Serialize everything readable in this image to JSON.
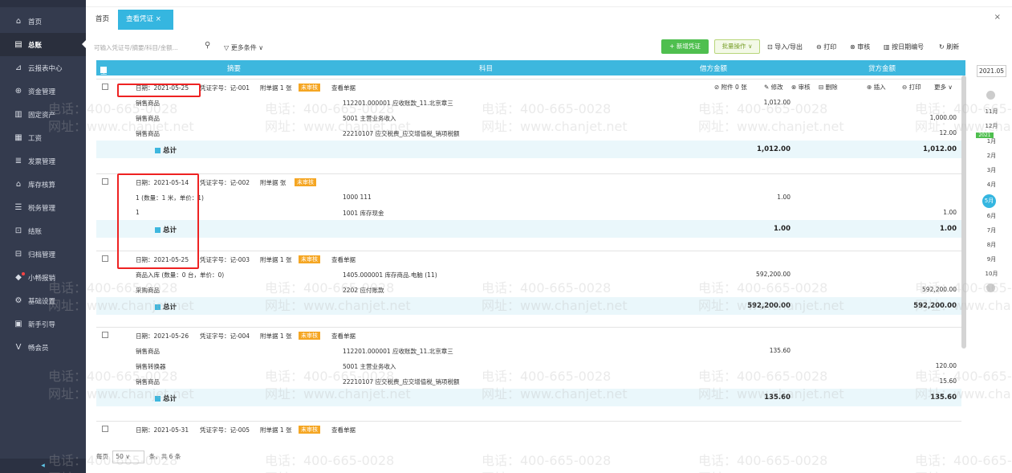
{
  "sidebar": {
    "items": [
      {
        "icon": "⌂",
        "label": "首页"
      },
      {
        "icon": "▤",
        "label": "总账"
      },
      {
        "icon": "⊿",
        "label": "云报表中心"
      },
      {
        "icon": "⊕",
        "label": "资金管理"
      },
      {
        "icon": "▥",
        "label": "固定资产"
      },
      {
        "icon": "▦",
        "label": "工资"
      },
      {
        "icon": "≣",
        "label": "发票管理"
      },
      {
        "icon": "⌂",
        "label": "库存核算"
      },
      {
        "icon": "☰",
        "label": "税务管理"
      },
      {
        "icon": "⊡",
        "label": "结账"
      },
      {
        "icon": "⊟",
        "label": "归档管理"
      },
      {
        "icon": "◆",
        "label": "小畅报销"
      },
      {
        "icon": "⚙",
        "label": "基础设置"
      },
      {
        "icon": "▣",
        "label": "新手引导"
      },
      {
        "icon": "V",
        "label": "畅会员"
      }
    ],
    "collapse_icon": "◂"
  },
  "tabs": {
    "home": "首页",
    "voucher": "查看凭证 ×",
    "close_all": "×"
  },
  "toolbar": {
    "search_placeholder": "可输入凭证号/摘要/科目/金额...",
    "more_filter": "▽ 更多条件 ∨",
    "new_voucher": "+ 新增凭证",
    "batch": "批量操作 ∨",
    "import_export": "⊡ 导入/导出",
    "print": "⊖ 打印",
    "review": "⊗ 审核",
    "renumber": "▥ 按日期编号",
    "refresh": "↻ 刷新"
  },
  "grid_head": {
    "select_all": "全选",
    "summary": "摘要",
    "account": "科目",
    "debit": "借方金额",
    "credit": "贷方金额"
  },
  "vouchers": [
    {
      "date": "日期：2021-05-25",
      "no": "凭证字号：记-001",
      "attach": "附单据 1 张",
      "status": "未审核",
      "view": "查看单据",
      "actions": [
        "⊘ 附件 0 张",
        "✎ 修改",
        "⊗ 审核",
        "⊟ 删除",
        "⊕ 插入",
        "⊖ 打印",
        "更多 ∨"
      ],
      "rows": [
        {
          "summary": "销售商品",
          "account": "112201.000001 应收账款_11.北京章三",
          "debit": "1,012.00",
          "credit": ""
        },
        {
          "summary": "销售商品",
          "account": "5001 主营业务收入",
          "debit": "",
          "credit": "1,000.00"
        },
        {
          "summary": "销售商品",
          "account": "22210107 应交税费_应交增值税_销项税额",
          "debit": "",
          "credit": "12.00"
        }
      ],
      "total_label": "总计",
      "total_debit": "1,012.00",
      "total_credit": "1,012.00"
    },
    {
      "date": "日期：2021-05-14",
      "no": "凭证字号：记-002",
      "attach": "附单据 张",
      "status": "未审核",
      "view": "",
      "rows": [
        {
          "summary": "1 (数量：1 米，单价：1)",
          "account": "1000 111",
          "debit": "1.00",
          "credit": ""
        },
        {
          "summary": "1",
          "account": "1001 库存现金",
          "debit": "",
          "credit": "1.00"
        }
      ],
      "total_label": "总计",
      "total_debit": "1.00",
      "total_credit": "1.00"
    },
    {
      "date": "日期：2021-05-25",
      "no": "凭证字号：记-003",
      "attach": "附单据 1 张",
      "status": "未审核",
      "view": "查看单据",
      "rows": [
        {
          "summary": "商品入库 (数量：0 台，单价：0)",
          "account": "1405.000001 库存商品.电脑 (11)",
          "debit": "592,200.00",
          "credit": ""
        },
        {
          "summary": "采购商品",
          "account": "2202 应付账款",
          "debit": "",
          "credit": "592,200.00"
        }
      ],
      "total_label": "总计",
      "total_debit": "592,200.00",
      "total_credit": "592,200.00"
    },
    {
      "date": "日期：2021-05-26",
      "no": "凭证字号：记-004",
      "attach": "附单据 1 张",
      "status": "未审核",
      "view": "查看单据",
      "rows": [
        {
          "summary": "销售商品",
          "account": "112201.000001 应收账款_11.北京章三",
          "debit": "135.60",
          "credit": ""
        },
        {
          "summary": "销售转换器",
          "account": "5001 主营业务收入",
          "debit": "",
          "credit": "120.00"
        },
        {
          "summary": "销售商品",
          "account": "22210107 应交税费_应交增值税_销项税额",
          "debit": "",
          "credit": "15.60"
        }
      ],
      "total_label": "总计",
      "total_debit": "135.60",
      "total_credit": "135.60"
    },
    {
      "date": "日期：2021-05-31",
      "no": "凭证字号：记-005",
      "attach": "附单据 1 张",
      "status": "未审核",
      "view": "查看单据"
    }
  ],
  "period": {
    "year": "2021.05",
    "months": [
      "11月",
      "12月",
      "1月",
      "2月",
      "3月",
      "4月",
      "5月",
      "6月",
      "7月",
      "8月",
      "9月",
      "10月"
    ],
    "year_badge": "2021",
    "current": "5月"
  },
  "footer": {
    "per_page": "每页",
    "size": "50",
    "suffix": "条，共 6 条"
  },
  "watermark": {
    "phone": "电话：400-665-0028",
    "site": "网址：www.chanjet.net"
  }
}
